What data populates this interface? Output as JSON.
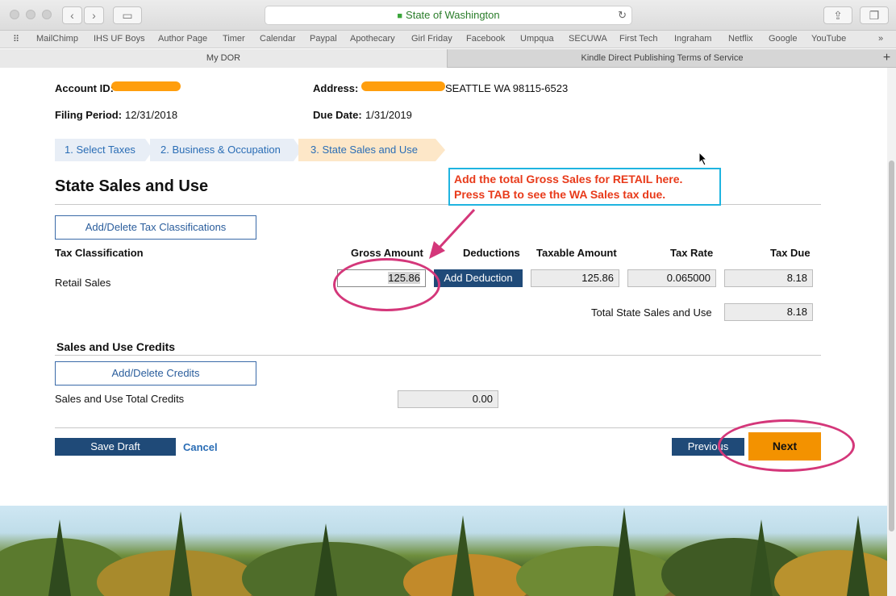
{
  "browser": {
    "url": "State of Washington",
    "bookmarks": [
      "MailChimp",
      "IHS UF Boys",
      "Author Page",
      "Timer",
      "Calendar",
      "Paypal",
      "Apothecary",
      "Girl Friday",
      "Facebook",
      "Umpqua",
      "SECUWA",
      "First Tech",
      "Ingraham",
      "Netflix",
      "Google",
      "YouTube"
    ],
    "tabs": [
      "My DOR",
      "Kindle Direct Publishing Terms of Service"
    ]
  },
  "header": {
    "account_label": "Account ID:",
    "address_label": "Address:",
    "address_value": "SEATTLE WA 98115-6523",
    "filing_label": "Filing Period:",
    "filing_value": "12/31/2018",
    "due_label": "Due Date:",
    "due_value": "1/31/2019"
  },
  "steps": [
    "1. Select Taxes",
    "2. Business & Occupation",
    "3. State Sales and Use"
  ],
  "section": {
    "title": "State Sales and Use",
    "add_delete_classifications": "Add/Delete Tax Classifications"
  },
  "table": {
    "headers": {
      "classification": "Tax Classification",
      "gross": "Gross Amount",
      "deductions": "Deductions",
      "taxable": "Taxable Amount",
      "rate": "Tax Rate",
      "due": "Tax Due"
    },
    "row": {
      "classification": "Retail Sales",
      "gross": "125.86",
      "add_deduction": "Add Deduction",
      "taxable": "125.86",
      "rate": "0.065000",
      "due": "8.18"
    },
    "total_label": "Total State Sales and Use",
    "total_value": "8.18"
  },
  "credits": {
    "title": "Sales and Use Credits",
    "add_delete": "Add/Delete Credits",
    "total_label": "Sales and Use Total Credits",
    "total_value": "0.00"
  },
  "actions": {
    "save": "Save Draft",
    "cancel": "Cancel",
    "previous": "Previous",
    "next": "Next"
  },
  "annotation": {
    "line1": "Add the total Gross Sales for RETAIL here.",
    "line2": "Press TAB to see the WA Sales tax due."
  }
}
